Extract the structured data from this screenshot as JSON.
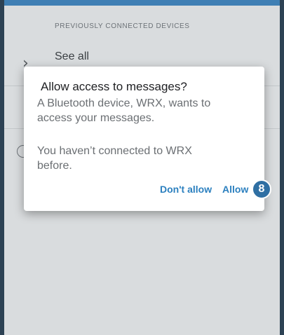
{
  "settings": {
    "section_header": "PREVIOUSLY CONNECTED DEVICES",
    "see_all_label": "See all"
  },
  "dialog": {
    "title": "Allow access to messages?",
    "body_line_1": "A Bluetooth device, WRX, wants to access your messages.",
    "body_line_2": "You haven’t connected to WRX before.",
    "deny_label": "Don't allow",
    "allow_label": "Allow"
  },
  "annotation": {
    "step_number": "8"
  },
  "colors": {
    "accent": "#2c80bf",
    "scrim_background": "#d9dcde",
    "badge": "#2f6fa3"
  },
  "icons": {
    "chevron": "chevron-right-icon",
    "info": "info-circle-icon"
  }
}
